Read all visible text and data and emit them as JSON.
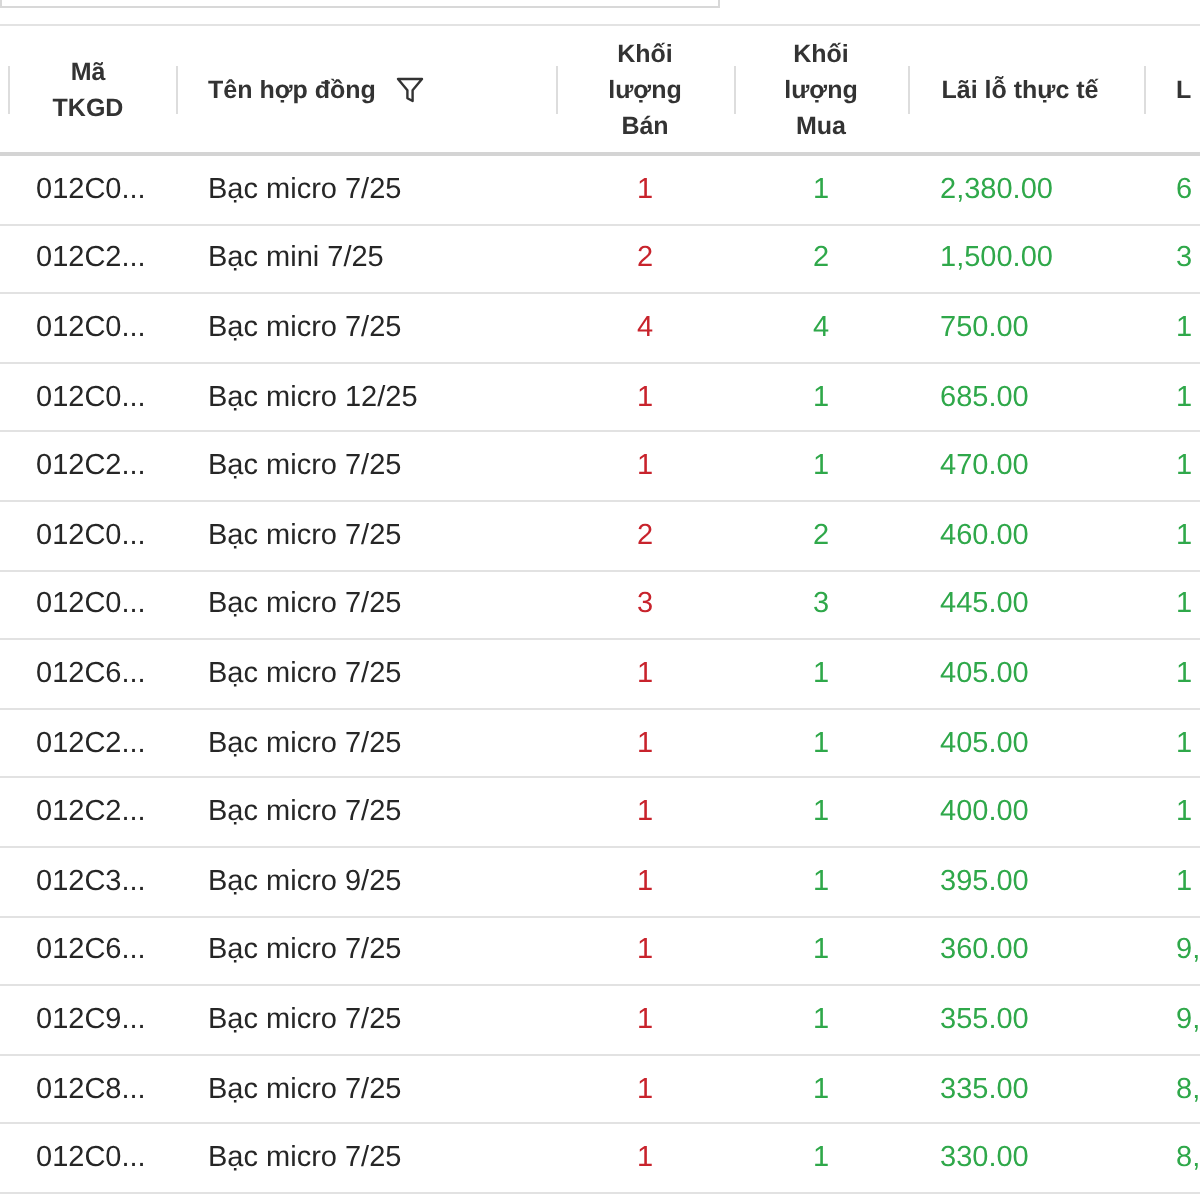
{
  "table": {
    "columns": [
      {
        "label": "Mã TKGD",
        "kind": "text",
        "filter": false
      },
      {
        "label": "Tên hợp đồng",
        "kind": "text",
        "filter": true
      },
      {
        "label": "Khối lượng Bán",
        "kind": "sell",
        "filter": false
      },
      {
        "label": "Khối lượng Mua",
        "kind": "buy",
        "filter": false
      },
      {
        "label": "Lãi lỗ thực tế",
        "kind": "gain",
        "filter": false
      },
      {
        "label": "L",
        "kind": "gain",
        "filter": false
      }
    ],
    "rows": [
      [
        "012C0...",
        "Bạc micro 7/25",
        "1",
        "1",
        "2,380.00",
        "6"
      ],
      [
        "012C2...",
        "Bạc mini 7/25",
        "2",
        "2",
        "1,500.00",
        "3"
      ],
      [
        "012C0...",
        "Bạc micro 7/25",
        "4",
        "4",
        "750.00",
        "1"
      ],
      [
        "012C0...",
        "Bạc micro 12/25",
        "1",
        "1",
        "685.00",
        "1"
      ],
      [
        "012C2...",
        "Bạc micro 7/25",
        "1",
        "1",
        "470.00",
        "1"
      ],
      [
        "012C0...",
        "Bạc micro 7/25",
        "2",
        "2",
        "460.00",
        "1"
      ],
      [
        "012C0...",
        "Bạc micro 7/25",
        "3",
        "3",
        "445.00",
        "1"
      ],
      [
        "012C6...",
        "Bạc micro 7/25",
        "1",
        "1",
        "405.00",
        "1"
      ],
      [
        "012C2...",
        "Bạc micro 7/25",
        "1",
        "1",
        "405.00",
        "1"
      ],
      [
        "012C2...",
        "Bạc micro 7/25",
        "1",
        "1",
        "400.00",
        "1"
      ],
      [
        "012C3...",
        "Bạc micro 9/25",
        "1",
        "1",
        "395.00",
        "1"
      ],
      [
        "012C6...",
        "Bạc micro 7/25",
        "1",
        "1",
        "360.00",
        "9,"
      ],
      [
        "012C9...",
        "Bạc micro 7/25",
        "1",
        "1",
        "355.00",
        "9,"
      ],
      [
        "012C8...",
        "Bạc micro 7/25",
        "1",
        "1",
        "335.00",
        "8,"
      ],
      [
        "012C0...",
        "Bạc micro 7/25",
        "1",
        "1",
        "330.00",
        "8,"
      ]
    ]
  }
}
